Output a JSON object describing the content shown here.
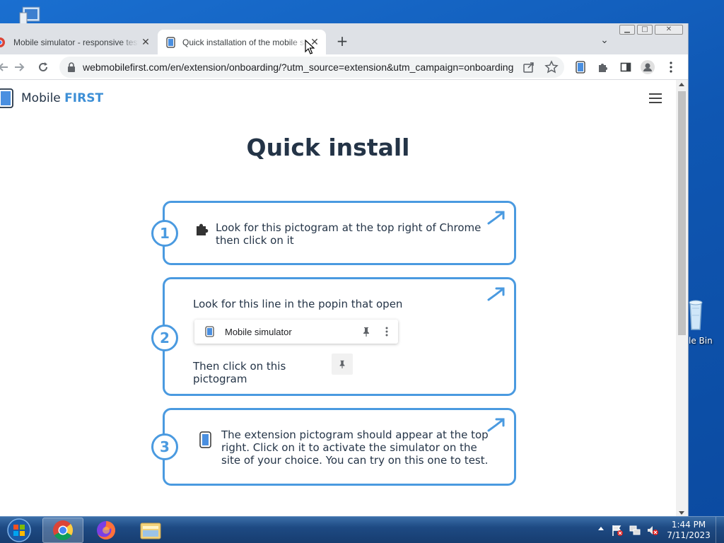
{
  "browser": {
    "tabs": [
      {
        "title": "Mobile simulator - responsive testing",
        "active": false
      },
      {
        "title": "Quick installation of the mobile simulator",
        "active": true
      }
    ],
    "url": "webmobilefirst.com/en/extension/onboarding/?utm_source=extension&utm_campaign=onboarding",
    "window_controls": {
      "minimize": "▁",
      "maximize": "□",
      "close": "✕"
    }
  },
  "page": {
    "brand": {
      "text": "Mobile ",
      "highlight": "FIRST"
    },
    "title": "Quick install",
    "steps": [
      {
        "number": "1",
        "text": "Look for this pictogram at the top right of Chrome then click on it"
      },
      {
        "number": "2",
        "text": "Look for this line in the popin that open",
        "popin_label": "Mobile simulator",
        "text_after": "Then click on this pictogram"
      },
      {
        "number": "3",
        "text": "The extension pictogram should appear at the top right. Click on it to activate the simulator on the site of your choice. You can try on this one to test."
      }
    ],
    "accent_color": "#4a9ae0"
  },
  "desktop": {
    "recycle_bin_label": "le Bin"
  },
  "taskbar": {
    "time": "1:44 PM",
    "date": "7/11/2023"
  }
}
